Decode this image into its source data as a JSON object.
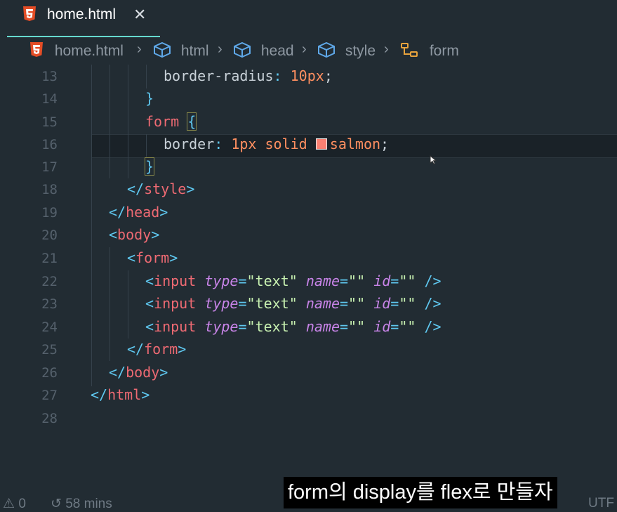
{
  "tab": {
    "title": "home.html",
    "close": "✕"
  },
  "breadcrumb": [
    {
      "label": "home.html",
      "icon": "html5-icon"
    },
    {
      "label": "html",
      "icon": "cube-icon"
    },
    {
      "label": "head",
      "icon": "cube-icon"
    },
    {
      "label": "style",
      "icon": "cube-icon"
    },
    {
      "label": "form",
      "icon": "css-selector-icon"
    }
  ],
  "breadcrumb_separator": "›",
  "lines": {
    "l13": {
      "num": "13"
    },
    "l14": {
      "num": "14"
    },
    "l15": {
      "num": "15"
    },
    "l16": {
      "num": "16"
    },
    "l17": {
      "num": "17"
    },
    "l18": {
      "num": "18"
    },
    "l19": {
      "num": "19"
    },
    "l20": {
      "num": "20"
    },
    "l21": {
      "num": "21"
    },
    "l22": {
      "num": "22"
    },
    "l23": {
      "num": "23"
    },
    "l24": {
      "num": "24"
    },
    "l25": {
      "num": "25"
    },
    "l26": {
      "num": "26"
    },
    "l27": {
      "num": "27"
    },
    "l28": {
      "num": "28"
    }
  },
  "code": {
    "border_radius_prop": "border-radius",
    "colon": ":",
    "border_radius_val": "10px",
    "semicolon": ";",
    "close_brace": "}",
    "form_selector": "form",
    "open_brace": "{",
    "border_prop": "border",
    "border_width": "1px",
    "border_style": "solid",
    "border_color": "salmon",
    "style_close_lt": "</",
    "style_tag": "style",
    "gt": ">",
    "lt": "<",
    "head_tag": "head",
    "body_tag": "body",
    "form_tag": "form",
    "input_tag": "input",
    "type_attr": "type",
    "eq": "=",
    "text_val": "\"text\"",
    "name_attr": "name",
    "empty_val": "\"\"",
    "id_attr": "id",
    "selfclose": "/>",
    "html_tag": "html"
  },
  "colors": {
    "salmon_swatch": "#fa8072",
    "accent_tab": "#66d9cf"
  },
  "status": {
    "problems": "0",
    "time": "58 mins",
    "encoding_partial": "UTF"
  },
  "subtitle": "form의 display를 flex로 만들자"
}
